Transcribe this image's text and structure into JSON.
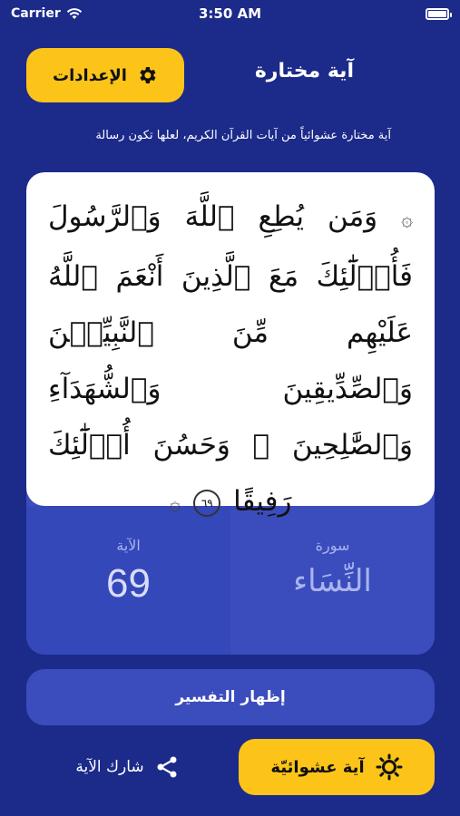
{
  "status_bar": {
    "carrier": "Carrier",
    "time": "3:50 AM"
  },
  "header": {
    "title": "آية مختارة",
    "settings_label": "الإعدادات"
  },
  "subtitle": "آية مختارة عشوائياً من آيات القرآن الكريم، لعلها تكون رسالة",
  "verse": {
    "open_bracket": "۞",
    "text": "وَمَن يُطِعِ ٱللَّهَ وَٱلرَّسُولَ فَأُو۟لَٰٓئِكَ مَعَ ٱلَّذِينَ أَنْعَمَ ٱللَّهُ عَلَيْهِم مِّنَ ٱلنَّبِيِّـۧنَ وَٱلصِّدِّيقِينَ وَٱلشُّهَدَآءِ وَٱلصَّٰلِحِينَ ۚ وَحَسُنَ أُو۟لَٰٓئِكَ رَفِيقًا",
    "ayah_marker": "٦٩",
    "close_bracket": "۞"
  },
  "info": {
    "surah_label": "سورة",
    "surah_value": "النِّسَاء",
    "ayah_label": "الآية",
    "ayah_value": "69"
  },
  "actions": {
    "tafsir_label": "إظهار التفسير",
    "random_label": "آية عشوائيّة",
    "share_label": "شارك الآية"
  },
  "colors": {
    "background": "#1c2a8a",
    "accent": "#fcc419",
    "panel": "#3b4dbd"
  },
  "icons": {
    "settings": "gear-icon",
    "random": "sun-icon",
    "share": "share-icon"
  }
}
